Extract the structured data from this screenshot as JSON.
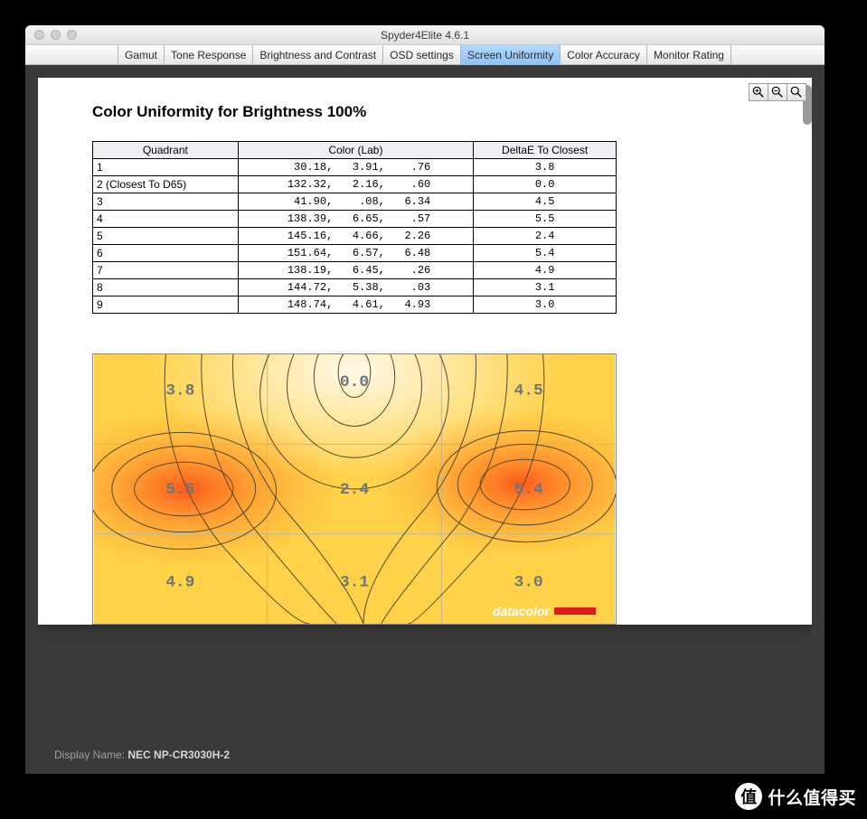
{
  "window": {
    "title": "Spyder4Elite 4.6.1"
  },
  "tabs": [
    {
      "label": "Gamut"
    },
    {
      "label": "Tone Response"
    },
    {
      "label": "Brightness and Contrast"
    },
    {
      "label": "OSD settings"
    },
    {
      "label": "Screen Uniformity",
      "selected": true
    },
    {
      "label": "Color Accuracy"
    },
    {
      "label": "Monitor Rating"
    }
  ],
  "report": {
    "title": "Color Uniformity for Brightness 100%",
    "headers": [
      "Quadrant",
      "Color (Lab)",
      "DeltaE To Closest"
    ],
    "rows": [
      {
        "quadrant": "1",
        "lab": "  30.18,   3.91,    .76",
        "deltaE": "3.8"
      },
      {
        "quadrant": "2 (Closest To D65)",
        "lab": " 132.32,   2.16,    .60",
        "deltaE": "0.0"
      },
      {
        "quadrant": "3",
        "lab": "  41.90,    .08,   6.34",
        "deltaE": "4.5"
      },
      {
        "quadrant": "4",
        "lab": " 138.39,   6.65,    .57",
        "deltaE": "5.5"
      },
      {
        "quadrant": "5",
        "lab": " 145.16,   4.66,   2.26",
        "deltaE": "2.4"
      },
      {
        "quadrant": "6",
        "lab": " 151.64,   6.57,   6.48",
        "deltaE": "5.4"
      },
      {
        "quadrant": "7",
        "lab": " 138.19,   6.45,    .26",
        "deltaE": "4.9"
      },
      {
        "quadrant": "8",
        "lab": " 144.72,   5.38,    .03",
        "deltaE": "3.1"
      },
      {
        "quadrant": "9",
        "lab": " 148.74,   4.61,   4.93",
        "deltaE": "3.0"
      }
    ],
    "brand": "datacolor"
  },
  "chart_data": {
    "type": "heatmap",
    "title": "Screen Uniformity DeltaE Map",
    "grid": [
      3,
      3
    ],
    "values": [
      [
        3.8,
        0.0,
        4.5
      ],
      [
        5.5,
        2.4,
        5.4
      ],
      [
        4.9,
        3.1,
        3.0
      ]
    ],
    "value_labels": [
      "3.8",
      "0.0",
      "4.5",
      "5.5",
      "2.4",
      "5.4",
      "4.9",
      "3.1",
      "3.0"
    ],
    "color_scale": {
      "low": "#fffde6",
      "mid": "#ffc43a",
      "high": "#ff5a1a"
    }
  },
  "footer": {
    "label": "Display Name: ",
    "value": "NEC NP-CR3030H-2"
  },
  "watermark": "什么值得买"
}
